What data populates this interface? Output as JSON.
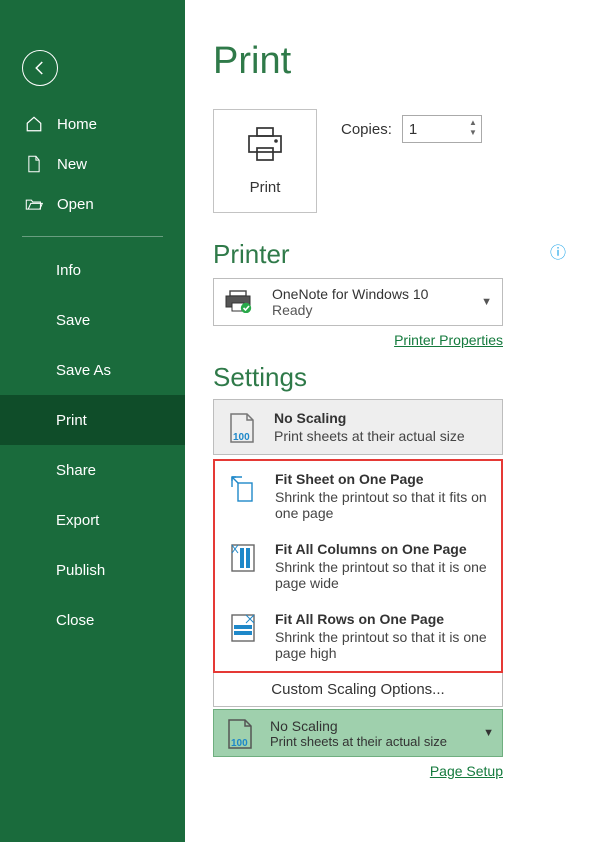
{
  "sidebar": {
    "items": [
      {
        "label": "Home"
      },
      {
        "label": "New"
      },
      {
        "label": "Open"
      }
    ],
    "subitems": [
      {
        "label": "Info"
      },
      {
        "label": "Save"
      },
      {
        "label": "Save As"
      },
      {
        "label": "Print"
      },
      {
        "label": "Share"
      },
      {
        "label": "Export"
      },
      {
        "label": "Publish"
      },
      {
        "label": "Close"
      }
    ]
  },
  "page": {
    "title": "Print",
    "print_label": "Print",
    "copies_label": "Copies:",
    "copies_value": "1"
  },
  "printer": {
    "heading": "Printer",
    "name": "OneNote for Windows 10",
    "status": "Ready",
    "properties_link": "Printer Properties"
  },
  "settings": {
    "heading": "Settings",
    "selected": {
      "title": "No Scaling",
      "desc": "Print sheets at their actual size",
      "icon_num": "100"
    },
    "options": [
      {
        "title": "Fit Sheet on One Page",
        "desc": "Shrink the printout so that it fits on one page"
      },
      {
        "title": "Fit All Columns on One Page",
        "desc": "Shrink the printout so that it is one page wide"
      },
      {
        "title": "Fit All Rows on One Page",
        "desc": "Shrink the printout so that it is one page high"
      }
    ],
    "custom_label": "Custom Scaling Options...",
    "summary": {
      "title": "No Scaling",
      "desc": "Print sheets at their actual size",
      "icon_num": "100"
    },
    "page_setup_link": "Page Setup"
  }
}
